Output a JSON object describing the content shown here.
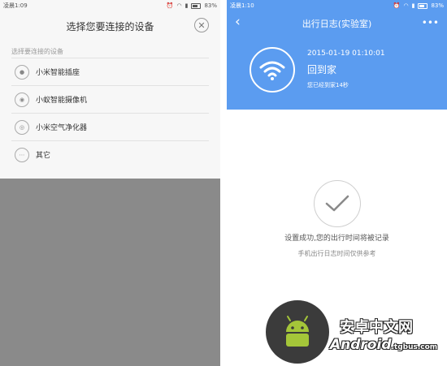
{
  "left": {
    "status": {
      "time": "凌晨1:09",
      "battery": "83%"
    },
    "sheet": {
      "title": "选择您要连接的设备",
      "section_label": "选择要连接的设备",
      "devices": [
        {
          "label": "小米智能插座",
          "icon": "socket-icon"
        },
        {
          "label": "小蚁智能摄像机",
          "icon": "camera-icon"
        },
        {
          "label": "小米空气净化器",
          "icon": "air-purifier-icon"
        },
        {
          "label": "其它",
          "icon": "more-dots-icon"
        }
      ]
    }
  },
  "right": {
    "status": {
      "time": "凌晨1:10",
      "battery": "83%"
    },
    "topbar": {
      "title": "出行日志(实验室)"
    },
    "hero": {
      "timestamp": "2015-01-19 01:10:01",
      "title": "回到家",
      "subtitle": "您已经到家14秒"
    },
    "success_text": "设置成功,您的出行时间将被记录",
    "note_text": "手机出行日志时间仅供参考"
  },
  "watermark": {
    "line1": "安卓中文网",
    "line2": "Android",
    "domain": ".tgbus.com"
  },
  "colors": {
    "accent": "#5b9cf0",
    "overlay": "#8a8a8a"
  }
}
